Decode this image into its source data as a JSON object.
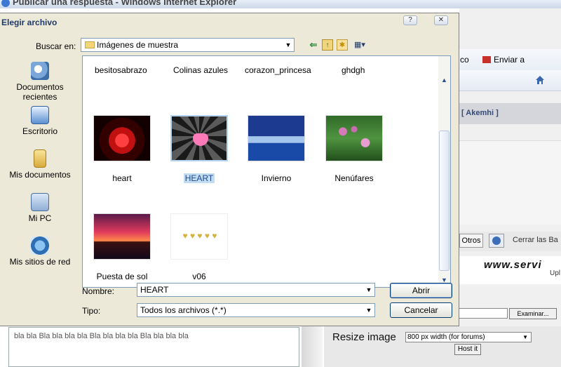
{
  "browser": {
    "title": "Publicar una respuesta - Windows Internet Explorer",
    "toolbar": {
      "dropdown_tail": "co",
      "send_label": "Enviar a"
    },
    "forum_user": "[ Akemhi ]",
    "otros_label": "Otros",
    "cerrar_label": "Cerrar las Ba",
    "host_logo": "www.servi",
    "host_sub": "Upl",
    "examinar_label": "Examinar...",
    "resize_label": "Resize image",
    "resize_value": "800 px width (for forums)",
    "host_it_label": "Host it",
    "editor_text": "bla bla Bla bla bla bla Bla bla bla bla Bla bla bla bla"
  },
  "dialog": {
    "title": "Elegir archivo",
    "help_button": "?",
    "close_button": "✕",
    "look_in": {
      "label": "Buscar en:",
      "value": "Imágenes de muestra"
    },
    "places": [
      {
        "label_line1": "Documentos",
        "label_line2": "recientes",
        "icon": "recent-documents-icon"
      },
      {
        "label_line1": "Escritorio",
        "label_line2": "",
        "icon": "desktop-icon"
      },
      {
        "label_line1": "Mis documentos",
        "label_line2": "",
        "icon": "my-documents-icon"
      },
      {
        "label_line1": "Mi PC",
        "label_line2": "",
        "icon": "my-computer-icon"
      },
      {
        "label_line1": "Mis sitios de red",
        "label_line2": "",
        "icon": "network-places-icon"
      }
    ],
    "top_names": [
      "besitosabrazo",
      "Colinas azules",
      "corazon_princesa",
      "ghdgh"
    ],
    "files": [
      {
        "name": "heart",
        "selected": false
      },
      {
        "name": "HEART",
        "selected": true
      },
      {
        "name": "Invierno",
        "selected": false
      },
      {
        "name": "Nenúfares",
        "selected": false
      },
      {
        "name": "Puesta de sol",
        "selected": false
      },
      {
        "name": "v06",
        "selected": false
      }
    ],
    "filename": {
      "label": "Nombre:",
      "value": "HEART"
    },
    "filetype": {
      "label": "Tipo:",
      "value": "Todos los archivos (*.*)"
    },
    "open_button": "Abrir",
    "cancel_button": "Cancelar"
  }
}
